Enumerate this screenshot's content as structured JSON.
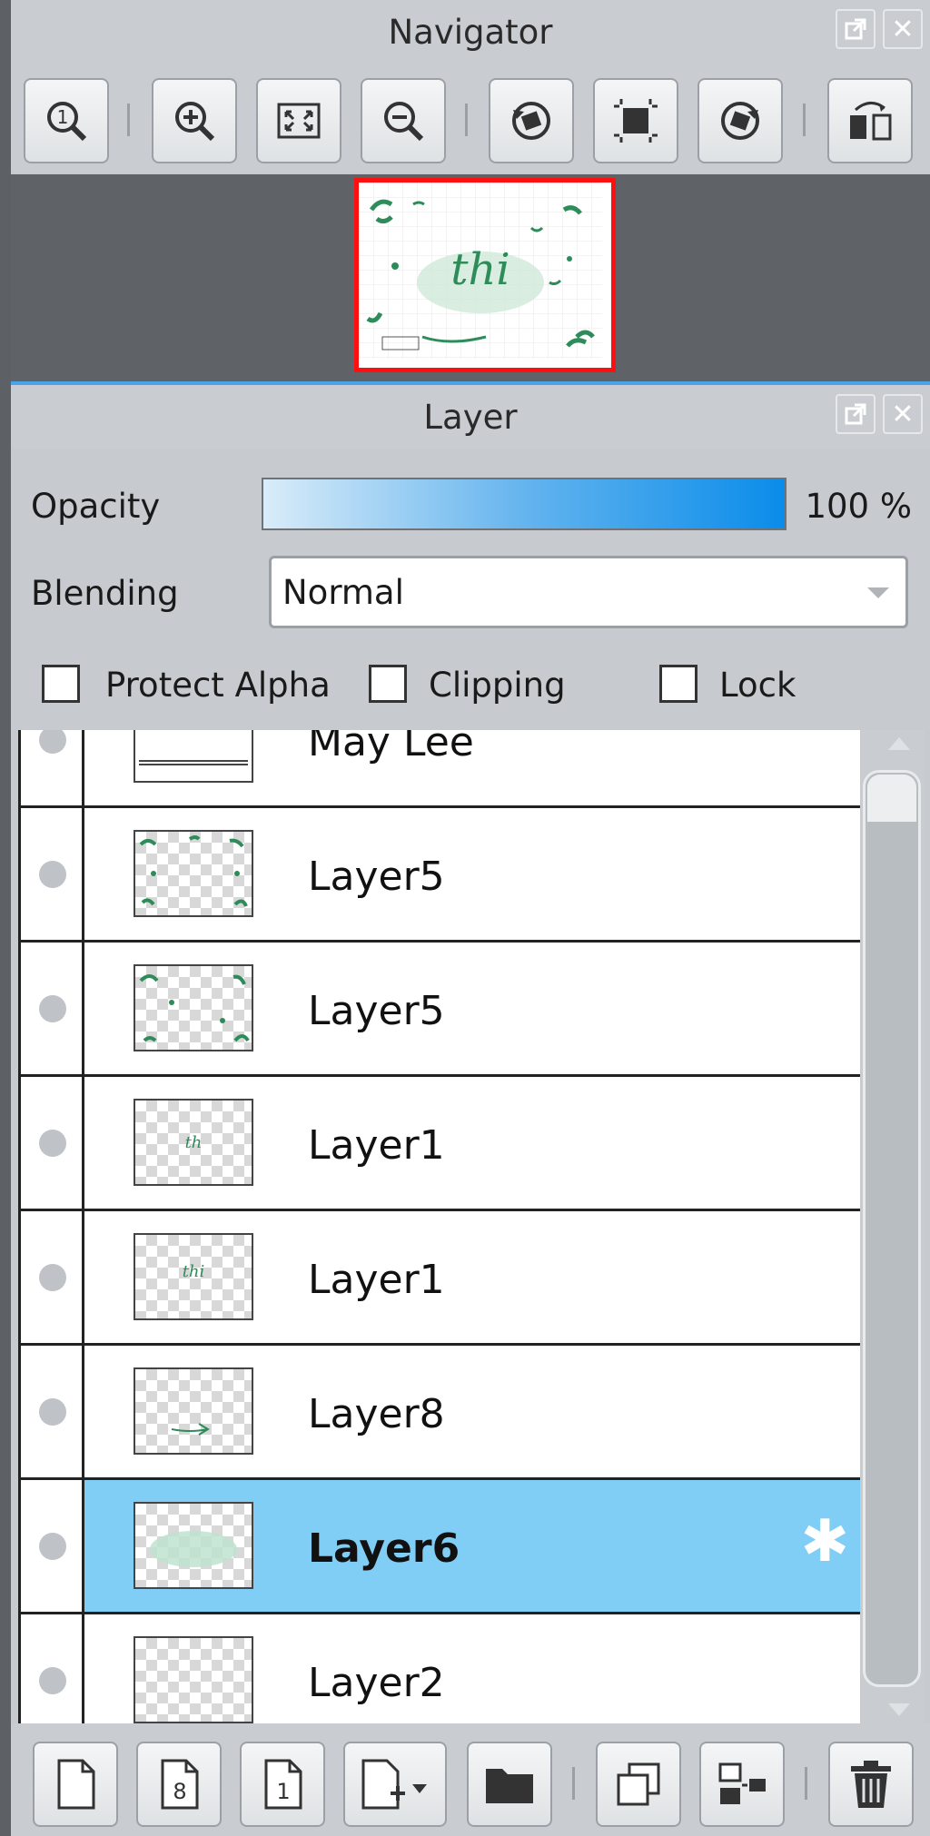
{
  "navigator": {
    "title": "Navigator",
    "toolbar_icons": [
      "zoom-actual-icon",
      "zoom-in-icon",
      "fit-screen-icon",
      "zoom-out-icon",
      "rotate-left-icon",
      "reset-view-icon",
      "rotate-right-icon",
      "flip-horizontal-icon"
    ]
  },
  "layer_panel": {
    "title": "Layer",
    "opacity_label": "Opacity",
    "opacity_value": "100 %",
    "opacity_fraction": 1.0,
    "blending_label": "Blending",
    "blending_value": "Normal",
    "checkboxes": {
      "protect_alpha": {
        "label": "Protect Alpha",
        "checked": false
      },
      "clipping": {
        "label": "Clipping",
        "checked": false
      },
      "lock": {
        "label": "Lock",
        "checked": false
      }
    },
    "layers": [
      {
        "name": "May Lee",
        "selected": false
      },
      {
        "name": "Layer5",
        "selected": false
      },
      {
        "name": "Layer5",
        "selected": false
      },
      {
        "name": "Layer1",
        "selected": false
      },
      {
        "name": "Layer1",
        "selected": false
      },
      {
        "name": "Layer8",
        "selected": false
      },
      {
        "name": "Layer6",
        "selected": true
      },
      {
        "name": "Layer2",
        "selected": false
      }
    ],
    "bottom_icons": [
      "new-layer-icon",
      "new-8bit-layer-icon",
      "new-1bit-layer-icon",
      "add-layer-menu-icon",
      "new-folder-icon",
      "duplicate-layer-icon",
      "merge-down-icon",
      "delete-layer-icon"
    ]
  },
  "colors": {
    "selected_row": "#80cdf5",
    "accent_blue": "#0a8cea",
    "thumbnail_frame": "#ff1010",
    "drawing_green": "#2e8b5a"
  }
}
